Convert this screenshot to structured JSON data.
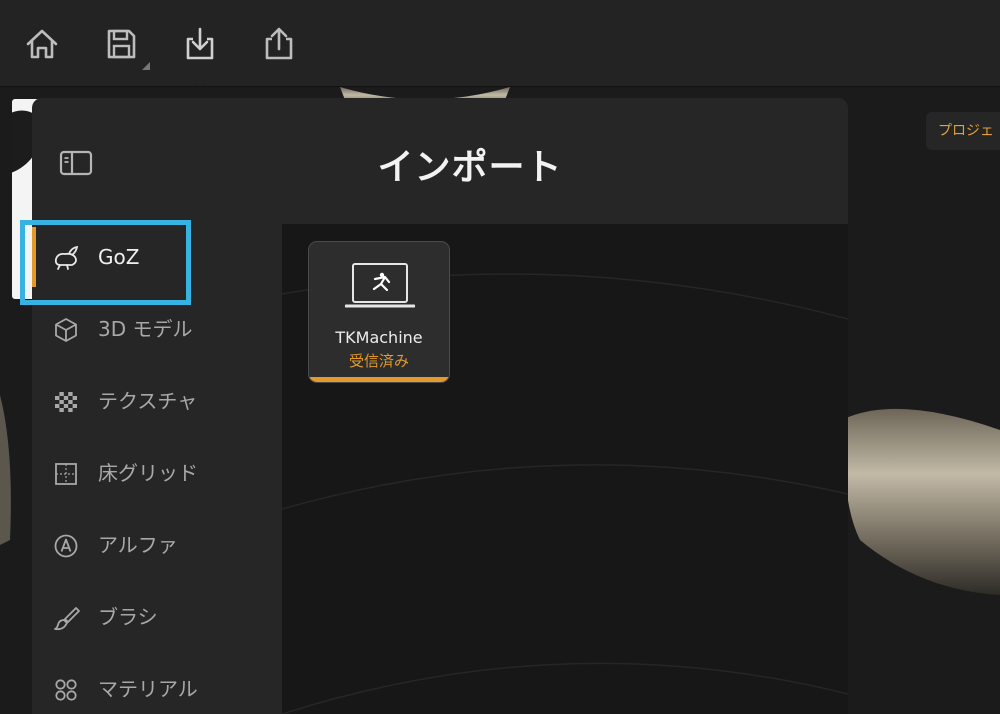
{
  "toolbar": {
    "buttons": [
      "home-icon",
      "save-icon",
      "import-icon",
      "export-icon"
    ]
  },
  "background": {
    "project_button_label": "プロジェ"
  },
  "panel": {
    "title": "インポート",
    "nav": [
      {
        "label": "GoZ",
        "icon": "rabbit-icon",
        "active": true
      },
      {
        "label": "3D モデル",
        "icon": "cube-icon"
      },
      {
        "label": "テクスチャ",
        "icon": "checker-icon"
      },
      {
        "label": "床グリッド",
        "icon": "grid-icon"
      },
      {
        "label": "アルファ",
        "icon": "alpha-circle-icon"
      },
      {
        "label": "ブラシ",
        "icon": "brush-icon"
      },
      {
        "label": "マテリアル",
        "icon": "material-dots-icon"
      }
    ],
    "devices": [
      {
        "name": "TKMachine",
        "status": "受信済み"
      }
    ]
  },
  "colors": {
    "accent": "#e29a2c",
    "highlight": "#36b3e3"
  }
}
